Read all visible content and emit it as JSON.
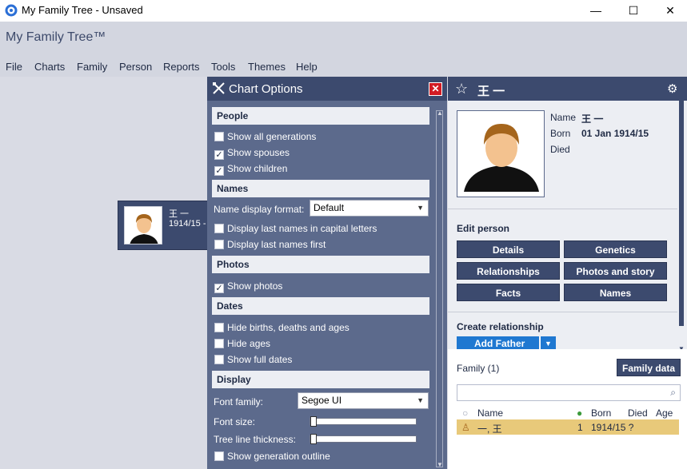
{
  "window": {
    "title": "My Family Tree - Unsaved",
    "minimize": "—",
    "maximize": "☐",
    "close": "✕"
  },
  "brand": "My Family Tree™",
  "menu": [
    "File",
    "Charts",
    "Family",
    "Person",
    "Reports",
    "Tools",
    "Themes",
    "Help"
  ],
  "tree_card": {
    "name": "王 一",
    "dates": "1914/15 -"
  },
  "chart_options": {
    "title": "Chart Options",
    "close": "✕",
    "sections": {
      "people": "People",
      "names": "Names",
      "photos": "Photos",
      "dates": "Dates",
      "display": "Display"
    },
    "show_all_generations": {
      "label": "Show all generations",
      "checked": false
    },
    "show_spouses": {
      "label": "Show spouses",
      "checked": true
    },
    "show_children": {
      "label": "Show children",
      "checked": true
    },
    "name_display_format_label": "Name display format:",
    "name_display_format_value": "Default",
    "display_last_names_caps": {
      "label": "Display last names in capital letters",
      "checked": false
    },
    "display_last_names_first": {
      "label": "Display last names first",
      "checked": false
    },
    "show_photos": {
      "label": "Show photos",
      "checked": true
    },
    "hide_births": {
      "label": "Hide births, deaths and ages",
      "checked": false
    },
    "hide_ages": {
      "label": "Hide ages",
      "checked": false
    },
    "show_full_dates": {
      "label": "Show full dates",
      "checked": false
    },
    "font_family_label": "Font family:",
    "font_family_value": "Segoe UI",
    "font_size_label": "Font size:",
    "font_size_level": 0,
    "tree_line_thickness_label": "Tree line thickness:",
    "tree_line_thickness_level": 0,
    "show_generation_outline": {
      "label": "Show generation outline",
      "checked": false
    }
  },
  "person": {
    "header_name": "王 一",
    "name_label": "Name",
    "name_value": "王 一",
    "born_label": "Born",
    "born_value": "01 Jan 1914/15",
    "died_label": "Died",
    "edit_person": "Edit person",
    "buttons": {
      "details": "Details",
      "genetics": "Genetics",
      "relationships": "Relationships",
      "photos_story": "Photos and story",
      "facts": "Facts",
      "names": "Names"
    },
    "create_relationship": "Create relationship",
    "add_father": "Add Father",
    "family_title": "Family (1)",
    "family_data_button": "Family data",
    "table_headers": {
      "name": "Name",
      "born": "Born",
      "died": "Died",
      "age": "Age"
    },
    "family_row": {
      "name": "一, 王",
      "count": "1",
      "born": "1914/15 ?",
      "died": "",
      "age": ""
    }
  },
  "colors": {
    "panel_dark": "#3c4a6e",
    "panel_mid": "#5c6a8c",
    "close_red": "#d21c24",
    "selected_row": "#e8c97a",
    "accent_blue": "#1f78d1"
  }
}
